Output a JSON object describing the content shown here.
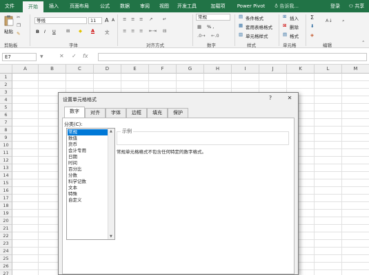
{
  "tabs": [
    "文件",
    "开始",
    "插入",
    "页面布局",
    "公式",
    "数据",
    "审阅",
    "视图",
    "开发工具",
    "加载项",
    "Power Pivot"
  ],
  "tell_me": "告诉我...",
  "login": "登录",
  "share": "共享",
  "ribbon": {
    "paste": "粘贴",
    "font_name": "等线",
    "font_size": "11",
    "number_format": "常规",
    "cond_format": "条件格式",
    "table_format": "套用表格格式",
    "cell_style": "单元格样式",
    "insert": "插入",
    "delete": "删除",
    "format": "格式",
    "groups": [
      "剪贴板",
      "字体",
      "对齐方式",
      "数字",
      "样式",
      "单元格",
      "编辑"
    ],
    "percent": "% ,",
    "bold": "B",
    "italic": "I",
    "underline": "U",
    "font_color": "A",
    "grow_font": "A",
    "shrink_font": "A"
  },
  "formula_bar": {
    "name_box": "E7",
    "cancel": "✕",
    "enter": "✓",
    "fx": "fx"
  },
  "columns": [
    "A",
    "B",
    "C",
    "D",
    "E",
    "F",
    "G",
    "H",
    "I",
    "J",
    "K",
    "L",
    "M"
  ],
  "rows": [
    "1",
    "2",
    "3",
    "4",
    "5",
    "6",
    "7",
    "8",
    "9",
    "10",
    "11",
    "12",
    "13",
    "14",
    "15",
    "16",
    "17",
    "18",
    "19",
    "20",
    "21",
    "22",
    "23",
    "24",
    "25",
    "26",
    "27"
  ],
  "dialog": {
    "title": "设置单元格格式",
    "help": "?",
    "close": "✕",
    "tabs": [
      "数字",
      "对齐",
      "字体",
      "边框",
      "填充",
      "保护"
    ],
    "category_label": "分类(C):",
    "categories": [
      "常规",
      "数值",
      "货币",
      "会计专用",
      "日期",
      "时间",
      "百分比",
      "分数",
      "科学记数",
      "文本",
      "特殊",
      "自定义"
    ],
    "sample_label": "示例",
    "description": "常规单元格格式不包含任何特定的数字格式。"
  },
  "colors": {
    "accent": "#217346",
    "selection": "#0078d7"
  }
}
